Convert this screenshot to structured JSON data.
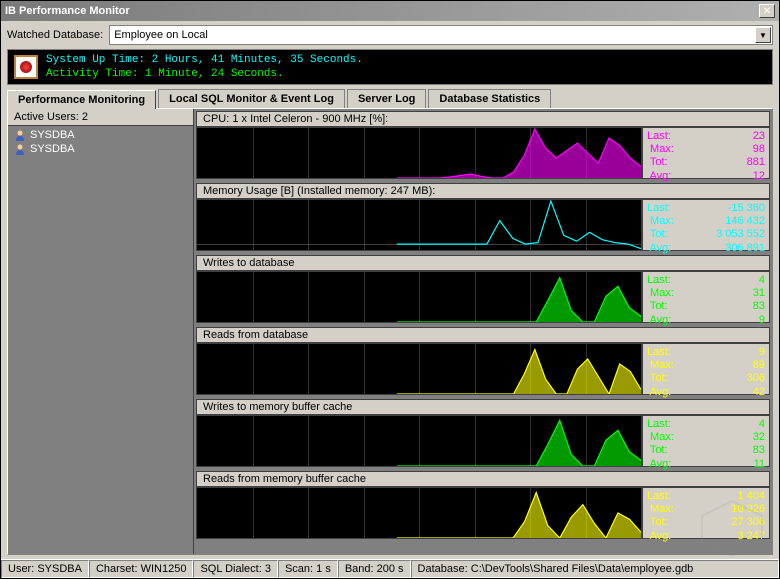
{
  "window": {
    "title": "IB Performance Monitor"
  },
  "watched": {
    "label": "Watched Database:",
    "value": "Employee on Local"
  },
  "banner": {
    "line1": "System Up Time: 2 Hours, 41 Minutes, 35 Seconds.",
    "line2": "Activity Time: 1 Minute, 24 Seconds."
  },
  "tabs": [
    {
      "label": "Performance Monitoring",
      "active": true
    },
    {
      "label": "Local SQL Monitor & Event Log",
      "active": false
    },
    {
      "label": "Server Log",
      "active": false
    },
    {
      "label": "Database Statistics",
      "active": false
    }
  ],
  "sidebar": {
    "header": "Active Users: 2",
    "items": [
      {
        "label": "SYSDBA"
      },
      {
        "label": "SYSDBA"
      }
    ]
  },
  "metrics": [
    {
      "title": "CPU: 1 x Intel Celeron - 900 MHz [%]:",
      "color": "#ff00ff",
      "css": "c-magenta",
      "stats": {
        "last": "23",
        "max": "98",
        "tot": "881",
        "avg": "12"
      }
    },
    {
      "title": "Memory Usage [B] (Installed memory: 247 MB):",
      "color": "#00ffff",
      "css": "c-cyan",
      "stats": {
        "last": "-15 360",
        "max": "146 432",
        "tot": "3 053 552",
        "avg": "306 891"
      }
    },
    {
      "title": "Writes to database",
      "color": "#00ff00",
      "css": "c-green",
      "stats": {
        "last": "4",
        "max": "31",
        "tot": "83",
        "avg": "9"
      }
    },
    {
      "title": "Reads from database",
      "color": "#ffff00",
      "css": "c-yellow",
      "stats": {
        "last": "9",
        "max": "89",
        "tot": "306",
        "avg": "42"
      }
    },
    {
      "title": "Writes to memory buffer cache",
      "color": "#00ff00",
      "css": "c-green",
      "stats": {
        "last": "4",
        "max": "32",
        "tot": "83",
        "avg": "11"
      }
    },
    {
      "title": "Reads from memory buffer cache",
      "color": "#ffff00",
      "css": "c-yellow",
      "stats": {
        "last": "1 404",
        "max": "10 926",
        "tot": "27 306",
        "avg": "3 247"
      }
    }
  ],
  "statusbar": {
    "user": "User: SYSDBA",
    "charset": "Charset: WIN1250",
    "dialect": "SQL Dialect: 3",
    "scan": "Scan: 1 s",
    "band": "Band: 200 s",
    "database": "Database: C:\\DevTools\\Shared Files\\Data\\employee.gdb"
  },
  "chart_data": [
    {
      "type": "line",
      "title": "CPU %",
      "ylim": [
        0,
        100
      ],
      "values": [
        0,
        0,
        0,
        0,
        0,
        2,
        5,
        8,
        3,
        0,
        0,
        12,
        45,
        98,
        60,
        40,
        55,
        70,
        50,
        30,
        80,
        65,
        40,
        23
      ]
    },
    {
      "type": "line",
      "title": "Memory Usage B",
      "ylim": [
        -20000,
        150000
      ],
      "values": [
        0,
        0,
        0,
        0,
        0,
        0,
        0,
        0,
        80000,
        20000,
        0,
        5000,
        146432,
        30000,
        10000,
        40000,
        15000,
        5000,
        0,
        -15360
      ]
    },
    {
      "type": "line",
      "title": "Writes to database",
      "ylim": [
        0,
        35
      ],
      "values": [
        0,
        0,
        0,
        0,
        0,
        0,
        0,
        0,
        0,
        0,
        0,
        0,
        0,
        15,
        31,
        8,
        0,
        0,
        18,
        25,
        10,
        4
      ]
    },
    {
      "type": "line",
      "title": "Reads from database",
      "ylim": [
        0,
        100
      ],
      "values": [
        0,
        0,
        0,
        0,
        0,
        0,
        0,
        0,
        0,
        0,
        0,
        0,
        40,
        89,
        30,
        0,
        0,
        50,
        70,
        35,
        0,
        60,
        45,
        9
      ]
    },
    {
      "type": "line",
      "title": "Writes to memory buffer cache",
      "ylim": [
        0,
        35
      ],
      "values": [
        0,
        0,
        0,
        0,
        0,
        0,
        0,
        0,
        0,
        0,
        0,
        0,
        0,
        15,
        32,
        8,
        0,
        0,
        18,
        25,
        10,
        4
      ]
    },
    {
      "type": "line",
      "title": "Reads from memory buffer cache",
      "ylim": [
        0,
        12000
      ],
      "values": [
        0,
        0,
        0,
        0,
        0,
        0,
        0,
        0,
        0,
        0,
        0,
        4000,
        10926,
        3000,
        0,
        5000,
        8000,
        3500,
        0,
        6000,
        4500,
        1404
      ]
    }
  ]
}
